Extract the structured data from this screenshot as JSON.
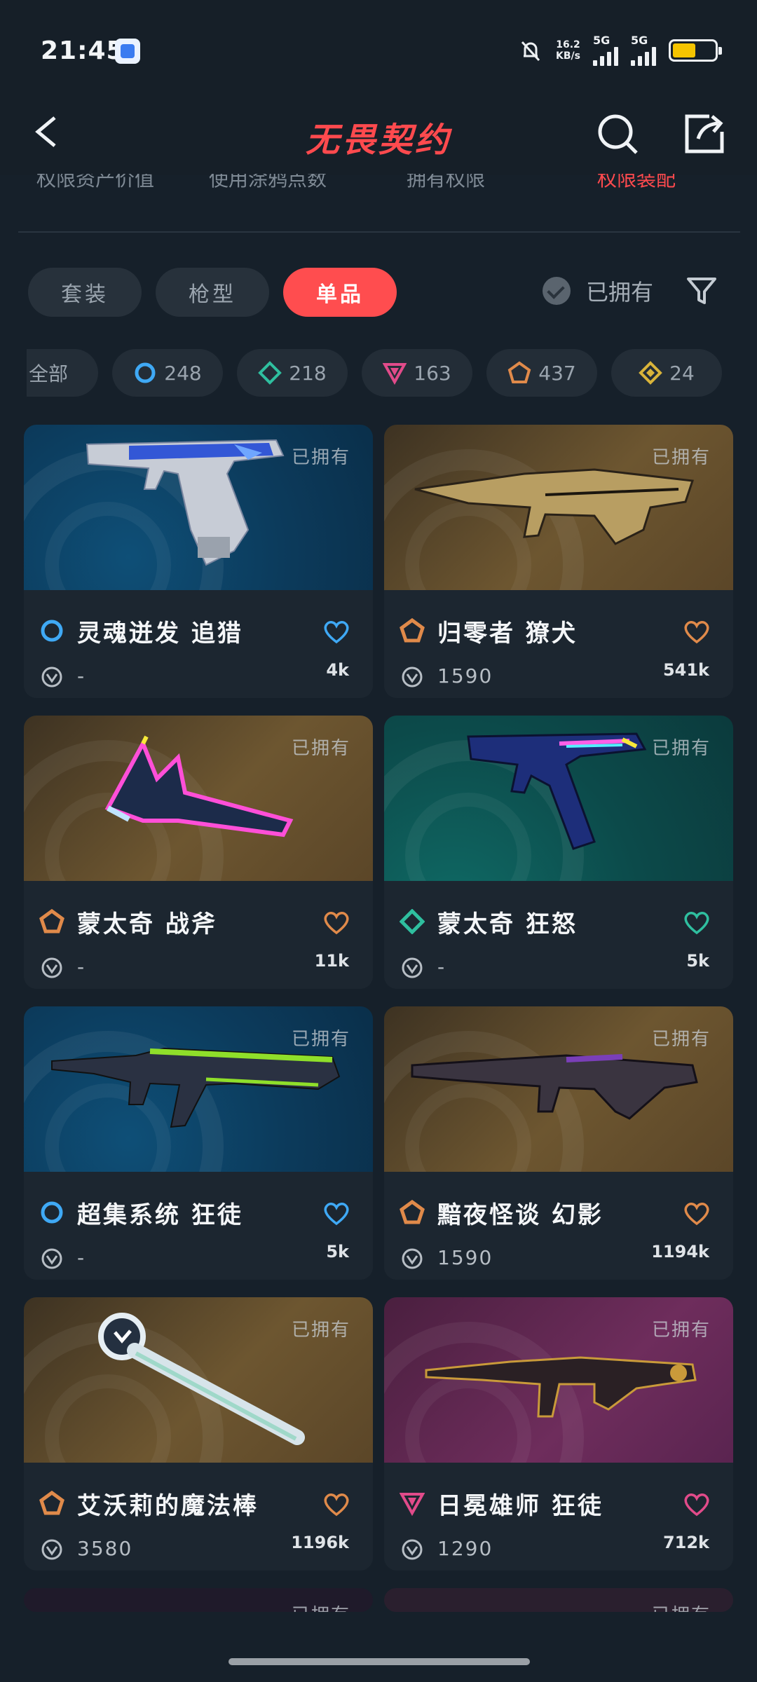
{
  "status_bar": {
    "time": "21:45",
    "net_speed_value": "16.2",
    "net_speed_unit": "KB/s",
    "sim1": "5G",
    "sim2": "5G",
    "battery_level": 0.55,
    "icons": [
      "mute-bell-icon",
      "signal-icon",
      "battery-icon"
    ]
  },
  "header": {
    "title": "无畏契约",
    "back_icon": "chevron-left-icon",
    "search_icon": "search-icon",
    "share_icon": "share-icon"
  },
  "subnav": {
    "items": [
      "权限资产价值",
      "使用涂鸦点数",
      "拥有权限",
      "权限装配"
    ],
    "active_index": 3
  },
  "tabs": [
    {
      "label": "套装",
      "active": false
    },
    {
      "label": "枪型",
      "active": false
    },
    {
      "label": "单品",
      "active": true
    }
  ],
  "owned_filter": {
    "label": "已拥有",
    "checked": false,
    "filter_icon": "filter-funnel-icon"
  },
  "rarity_chips": [
    {
      "label": "全部",
      "count": ""
    },
    {
      "label": "",
      "count": "248",
      "color": "#3fa9f5",
      "shape": "circle"
    },
    {
      "label": "",
      "count": "218",
      "color": "#2fbf9f",
      "shape": "diamond"
    },
    {
      "label": "",
      "count": "163",
      "color": "#e14b8a",
      "shape": "triangle"
    },
    {
      "label": "",
      "count": "437",
      "color": "#e08a4a",
      "shape": "pentagon"
    },
    {
      "label": "",
      "count": "24",
      "color": "#d9b43a",
      "shape": "diamond-outline"
    }
  ],
  "cards": [
    {
      "name": "灵魂迸发 追猎",
      "price": "-",
      "likes": "4k",
      "owned": "已拥有",
      "rarity_color": "#3fa9f5",
      "rarity_shape": "circle",
      "bg": "blue",
      "weapon": "pistol"
    },
    {
      "name": "归零者 獠犬",
      "price": "1590",
      "likes": "541k",
      "owned": "已拥有",
      "rarity_color": "#e08a4a",
      "rarity_shape": "pentagon",
      "bg": "gold",
      "weapon": "smg"
    },
    {
      "name": "蒙太奇 战斧",
      "price": "-",
      "likes": "11k",
      "owned": "已拥有",
      "rarity_color": "#e08a4a",
      "rarity_shape": "pentagon",
      "bg": "gold",
      "weapon": "axe"
    },
    {
      "name": "蒙太奇 狂怒",
      "price": "-",
      "likes": "5k",
      "owned": "已拥有",
      "rarity_color": "#2fbf9f",
      "rarity_shape": "diamond",
      "bg": "teal",
      "weapon": "pistol2"
    },
    {
      "name": "超集系统 狂徒",
      "price": "-",
      "likes": "5k",
      "owned": "已拥有",
      "rarity_color": "#3fa9f5",
      "rarity_shape": "circle",
      "bg": "blue",
      "weapon": "rifle"
    },
    {
      "name": "黯夜怪谈 幻影",
      "price": "1590",
      "likes": "1194k",
      "owned": "已拥有",
      "rarity_color": "#e08a4a",
      "rarity_shape": "pentagon",
      "bg": "gold",
      "weapon": "rifle2"
    },
    {
      "name": "艾沃莉的魔法棒",
      "price": "3580",
      "likes": "1196k",
      "owned": "已拥有",
      "rarity_color": "#e08a4a",
      "rarity_shape": "pentagon",
      "bg": "gold",
      "weapon": "wand"
    },
    {
      "name": "日冕雄师 狂徒",
      "price": "1290",
      "likes": "712k",
      "owned": "已拥有",
      "rarity_color": "#e14b8a",
      "rarity_shape": "triangle",
      "bg": "pink",
      "weapon": "rifle3"
    }
  ],
  "partial_cards": [
    "已拥有",
    "已拥有"
  ]
}
